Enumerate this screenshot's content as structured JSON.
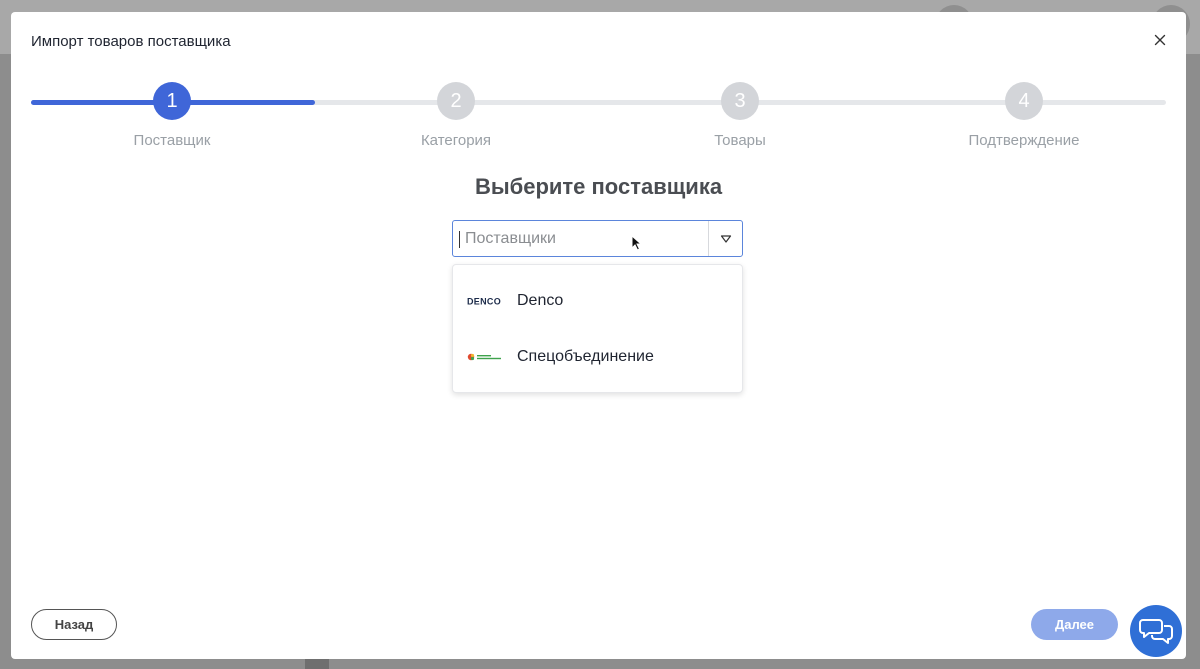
{
  "modal": {
    "title": "Импорт товаров поставщика"
  },
  "stepper": {
    "current_step": 1,
    "progress_fraction": 0.25,
    "steps": [
      {
        "number": "1",
        "label": "Поставщик"
      },
      {
        "number": "2",
        "label": "Категория"
      },
      {
        "number": "3",
        "label": "Товары"
      },
      {
        "number": "4",
        "label": "Подтверждение"
      }
    ]
  },
  "main": {
    "heading": "Выберите поставщика"
  },
  "supplier_select": {
    "placeholder": "Поставщики",
    "value": "",
    "toggle_icon": "chevron-down-icon",
    "options": [
      {
        "label": "Denco",
        "logo_text": "DENCO",
        "icon": "denco-logo"
      },
      {
        "label": "Спецобъединение",
        "icon": "specob-logo"
      }
    ]
  },
  "footer": {
    "back_label": "Назад",
    "next_label": "Далее",
    "chat_icon": "chat-bubbles-icon"
  },
  "colors": {
    "accent": "#3f66d8",
    "inactive_step": "#d3d5d9",
    "next_button": "#8ea9ea",
    "chat_button": "#2f6fd6"
  }
}
